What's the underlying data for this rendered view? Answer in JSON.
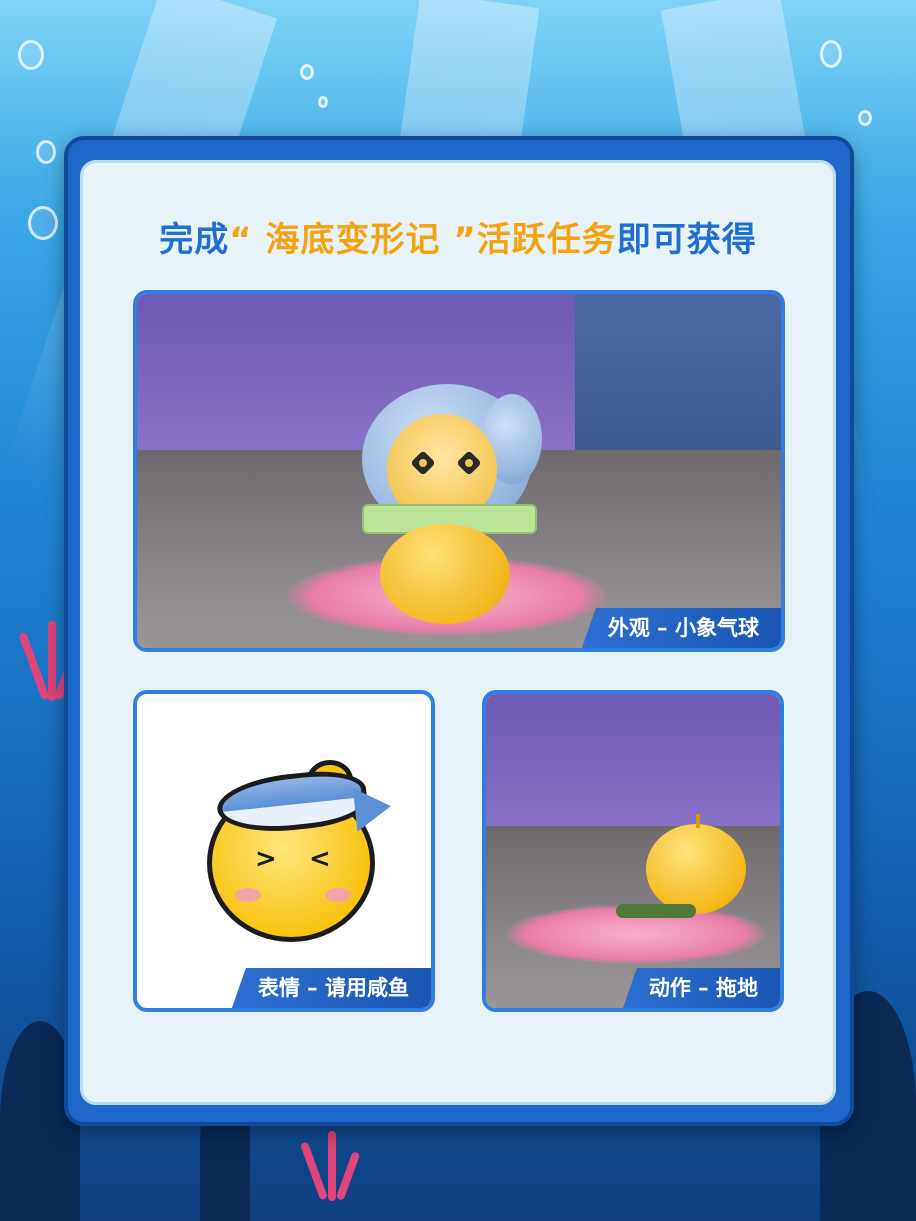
{
  "title": {
    "part1": "完成",
    "quote_open": "“",
    "highlight": " 海底变形记 ",
    "quote_close": "”",
    "part2": "活跃任务",
    "part3": "即可获得"
  },
  "rewards": {
    "outfit": {
      "label": "外观 – 小象气球"
    },
    "emote": {
      "label": "表情 – 请用咸鱼"
    },
    "action": {
      "label": "动作 – 拖地"
    }
  },
  "colors": {
    "title_blue": "#1f6fd1",
    "title_orange": "#f5a20f",
    "frame_blue": "#1f68c9",
    "panel_bg": "#e8f3f9"
  }
}
